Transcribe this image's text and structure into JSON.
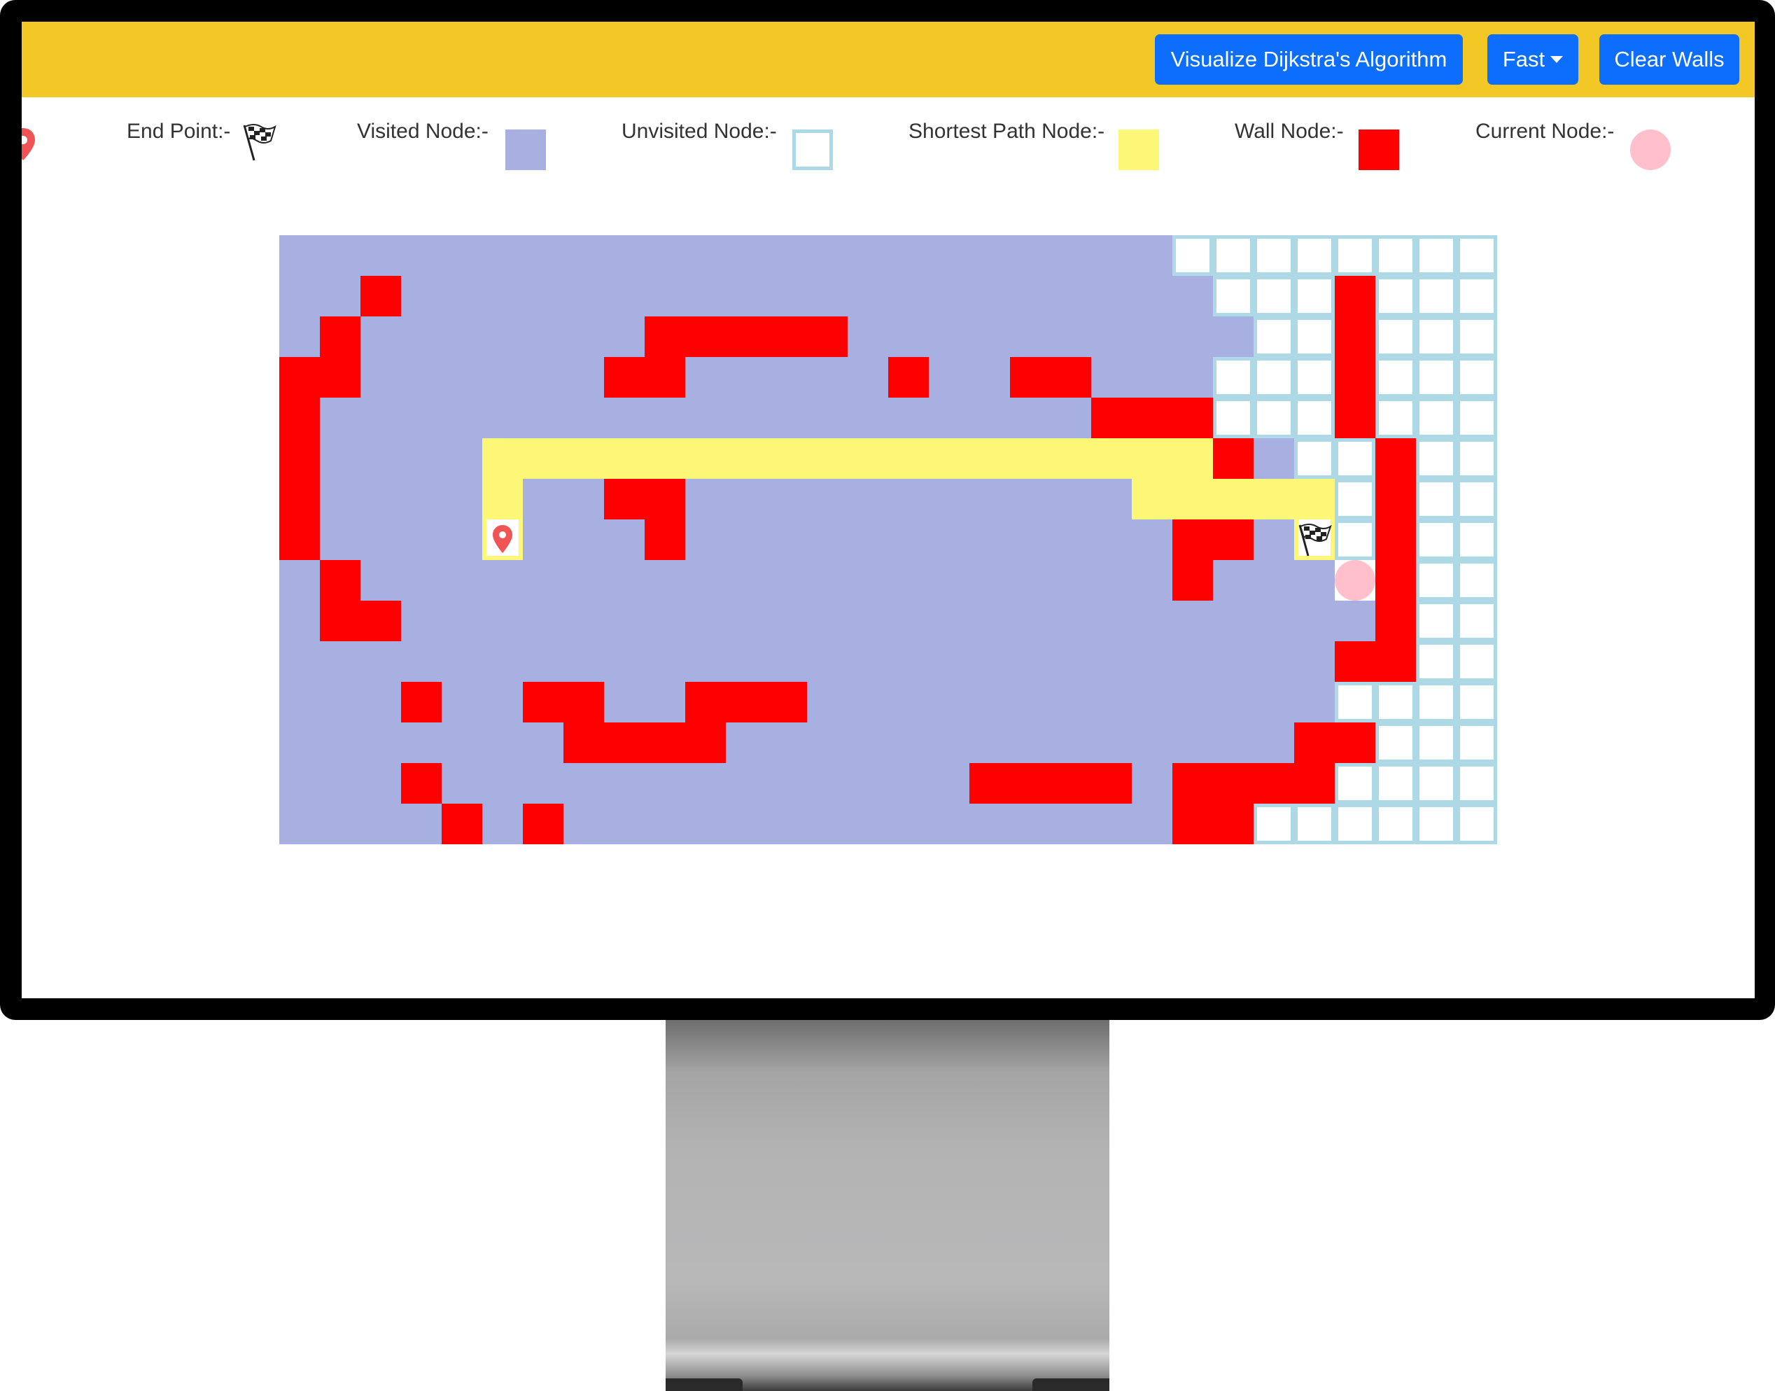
{
  "navbar": {
    "visualize_label": "Visualize Dijkstra's Algorithm",
    "speed_label": "Fast",
    "clear_label": "Clear Walls",
    "bg_color": "#f3c726",
    "button_color": "#0d6efd"
  },
  "legend": {
    "start_icon": "map-pin-icon",
    "end_label": "End Point:-",
    "end_icon": "checkered-flag-icon",
    "visited_label": "Visited Node:-",
    "unvisited_label": "Unvisited Node:-",
    "shortest_label": "Shortest Path Node:-",
    "wall_label": "Wall Node:-",
    "current_label": "Current Node:-"
  },
  "colors": {
    "visited": "#a7b0e1",
    "unvisited_border": "#add8e6",
    "path": "#fdf778",
    "wall": "#ff0000",
    "current": "#ffc0cb"
  },
  "grid": {
    "rows": 15,
    "cols": 30,
    "start": [
      7,
      5
    ],
    "end": [
      7,
      25
    ],
    "current": [
      8,
      26
    ],
    "cells": [
      "VVVVVVVVVVVVVVVVVVVVVVUUUUUUUU",
      "VVWVVVVVVVVVVVVVVVVVVVVUUUWUUU",
      "VWVVVVVVVWWWWWVVVVVVVVVVUUWUUU",
      "WWVVVVVVWWVVVVVWVVWWVVVUUUWUUU",
      "WVVVVVVVVVVVVVVVVVVVWWWUUUWUUU",
      "WVVVVPPPPPPPPPPPPPPPPPPWVUUWUU",
      "WVVVVPVVWWVVVVVVVVVVVPPPPPUWUU",
      "WVVVVSVVVWVVVVVVVVVVVVWWVEUWUU",
      "VWVVVVVVVVVVVVVVVVVVVVWVVVCWUU",
      "VWWVVVVVVVVVVVVVVVVVVVVVVVVWUU",
      "VVVVVVVVVVVVVVVVVVVVVVVVVVWWUU",
      "VVVWVVWWVVWWWVVVVVVVVVVVVVUUUU",
      "VVVVVVVWWWWVVVVVVVVVVVVVVWWUUU",
      "VVVWVVVVVVVVVVVVVWWWWVWWWWUUUU",
      "VVVVWVWVVVVVVVVVVVVVVVWWUUUUUU"
    ]
  }
}
